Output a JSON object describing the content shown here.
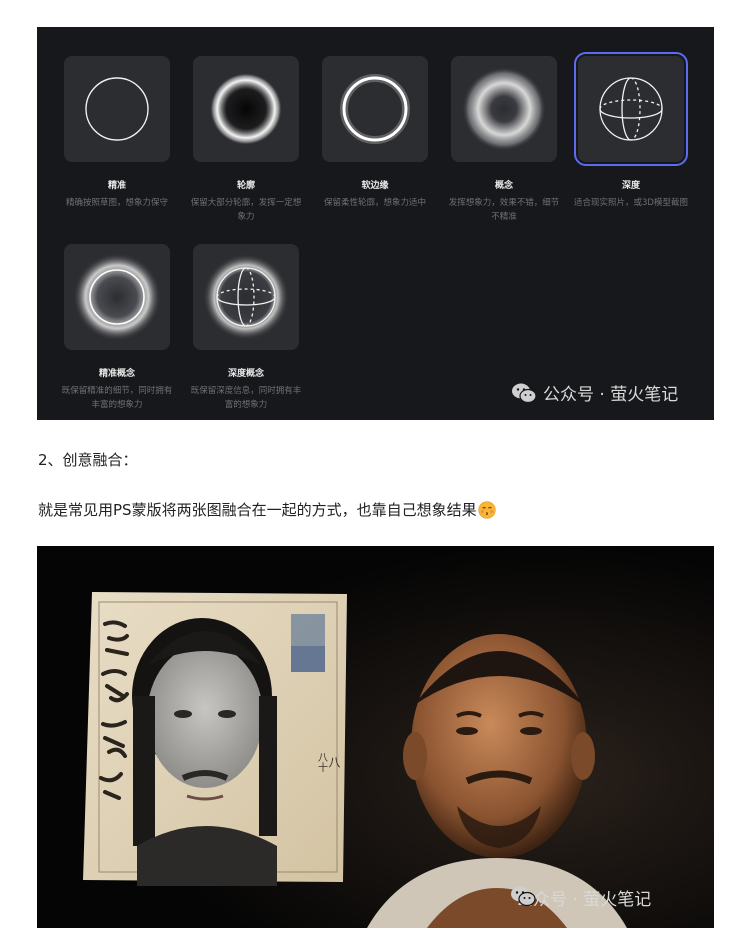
{
  "panel": {
    "options": [
      {
        "title": "精准",
        "desc": "精确按照草图，想象力保守",
        "icon": "thin-ring-icon",
        "selected": false
      },
      {
        "title": "轮廓",
        "desc": "保留大部分轮廓，发挥一定想象力",
        "icon": "glow-ring-icon",
        "selected": false
      },
      {
        "title": "软边缘",
        "desc": "保留柔性轮廓，想象力适中",
        "icon": "soft-ring-icon",
        "selected": false
      },
      {
        "title": "概念",
        "desc": "发挥想象力，效果不错，细节不精准",
        "icon": "blur-ring-icon",
        "selected": false
      },
      {
        "title": "深度",
        "desc": "适合现实照片，或3D模型截图",
        "icon": "sphere-icon",
        "selected": true
      },
      {
        "title": "精准概念",
        "desc": "既保留精准的细节，同时拥有丰富的想象力",
        "icon": "ring-halo-icon",
        "selected": false
      },
      {
        "title": "深度概念",
        "desc": "既保留深度信息，同时拥有丰富的想象力",
        "icon": "glow-sphere-icon",
        "selected": false
      }
    ],
    "watermark": "公众号 · 萤火笔记"
  },
  "text": {
    "heading": "2、创意融合：",
    "body": "就是常见用PS蒙版将两张图融合在一起的方式，也靠自己想象结果"
  },
  "photo": {
    "watermark": "公众号 · 萤火笔记",
    "document_numbers": [
      "八十",
      "八"
    ]
  },
  "colors": {
    "panel_bg": "#17181b",
    "card_bg": "#2c2d31",
    "selected_outline": "#5b6cf2"
  }
}
